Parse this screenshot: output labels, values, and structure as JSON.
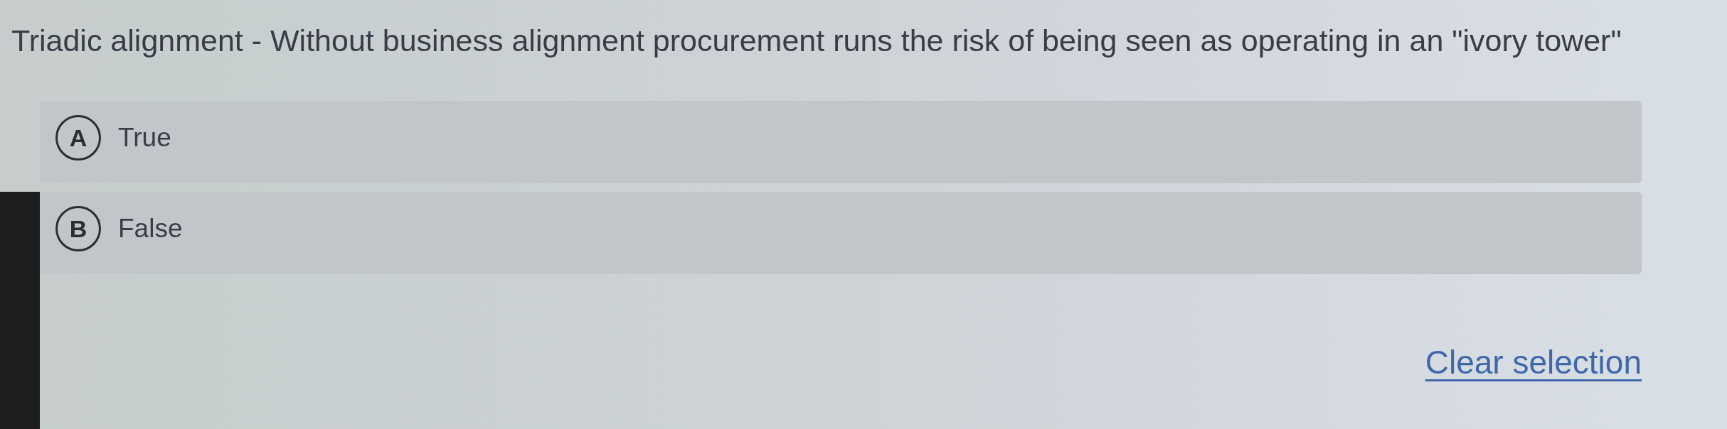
{
  "question": {
    "text": "Triadic alignment - Without business alignment procurement runs the risk of being seen as operating in an \"ivory tower\""
  },
  "options": [
    {
      "letter": "A",
      "label": "True",
      "selected": false
    },
    {
      "letter": "B",
      "label": "False",
      "selected": false
    }
  ],
  "clear_link": {
    "label": "Clear selection"
  }
}
